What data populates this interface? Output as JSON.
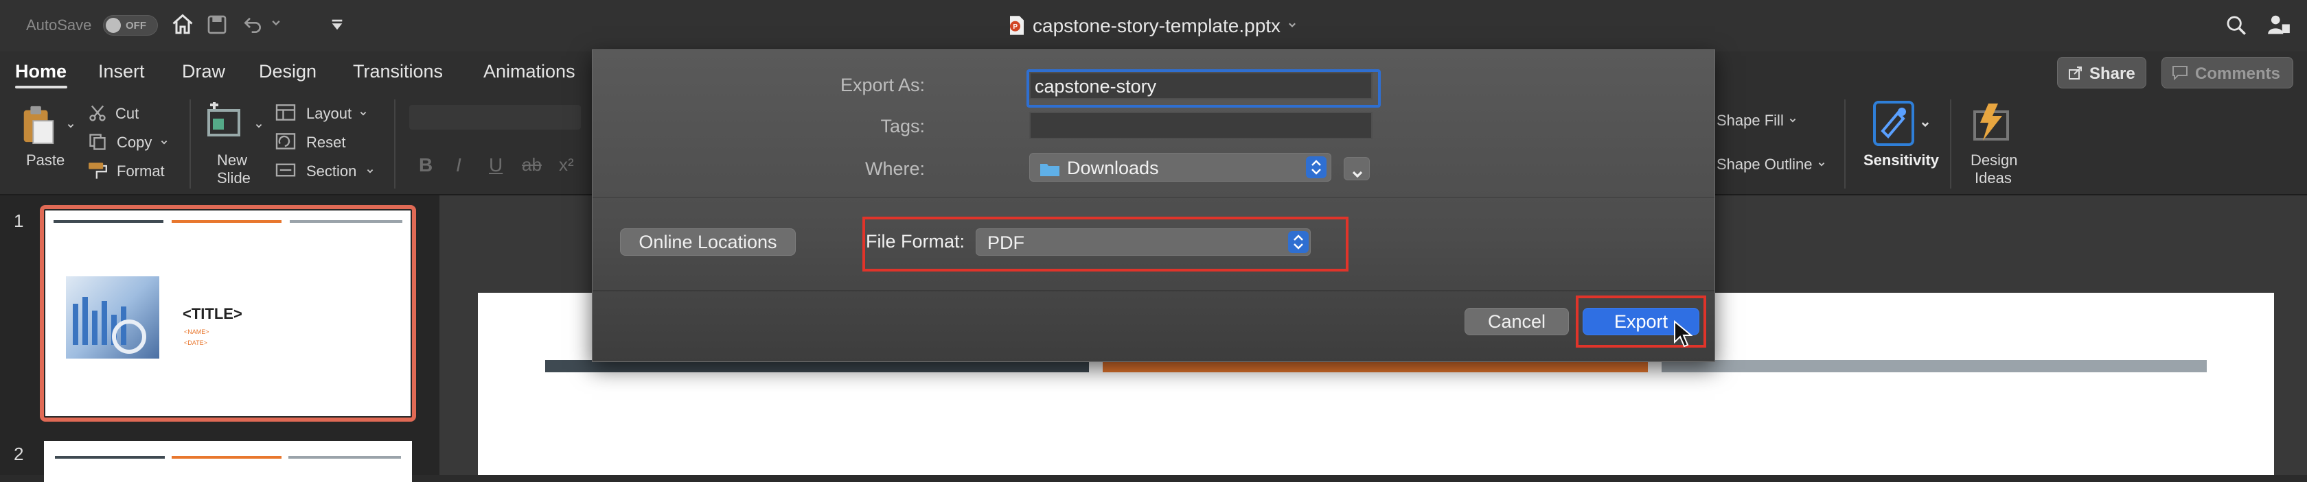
{
  "titlebar": {
    "autosave_label": "AutoSave",
    "autosave_state": "OFF",
    "document_title": "capstone-story-template.pptx"
  },
  "tabs": [
    "Home",
    "Insert",
    "Draw",
    "Design",
    "Transitions",
    "Animations"
  ],
  "header_buttons": {
    "share": "Share",
    "comments": "Comments"
  },
  "ribbon": {
    "paste": "Paste",
    "cut": "Cut",
    "copy": "Copy",
    "format": "Format",
    "new_slide_line1": "New",
    "new_slide_line2": "Slide",
    "layout": "Layout",
    "reset": "Reset",
    "section": "Section",
    "shape_fill": "Shape Fill",
    "shape_outline": "Shape Outline",
    "sensitivity": "Sensitivity",
    "design_ideas_line1": "Design",
    "design_ideas_line2": "Ideas"
  },
  "slides": [
    {
      "number": "1",
      "title": "<TITLE>",
      "name": "<NAME>",
      "date": "<DATE>"
    },
    {
      "number": "2"
    }
  ],
  "dialog": {
    "export_as_label": "Export As:",
    "export_as_value": "capstone-story",
    "tags_label": "Tags:",
    "tags_value": "",
    "where_label": "Where:",
    "where_value": "Downloads",
    "online_locations": "Online Locations",
    "file_format_label": "File Format:",
    "file_format_value": "PDF",
    "cancel": "Cancel",
    "export": "Export"
  },
  "colors": {
    "accent_orange": "#e8772e",
    "slate": "#3f4a52",
    "gray_bar": "#9aa3aa",
    "highlight_red": "#e0342a",
    "primary_blue": "#2f6fe3"
  }
}
